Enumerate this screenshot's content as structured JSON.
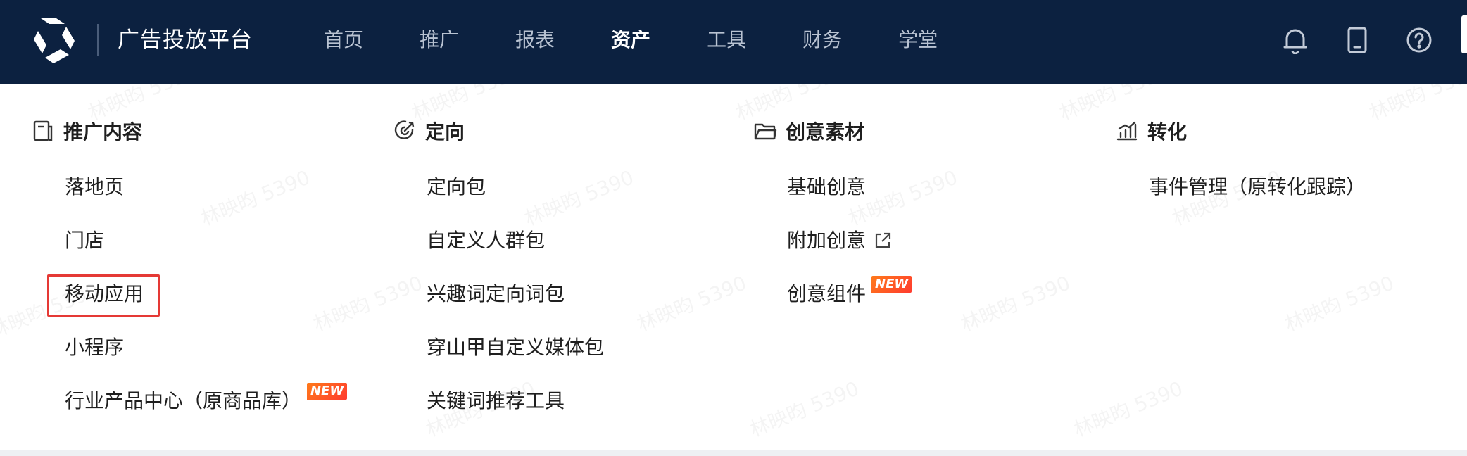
{
  "header": {
    "brand": "广告投放平台",
    "nav": [
      "首页",
      "推广",
      "报表",
      "资产",
      "工具",
      "财务",
      "学堂"
    ],
    "active_index": 3,
    "icons": [
      "bell-icon",
      "tablet-icon",
      "help-icon"
    ]
  },
  "columns": [
    {
      "title": "推广内容",
      "icon": "document-icon",
      "items": [
        "落地页",
        "门店",
        "移动应用",
        "小程序",
        "行业产品中心（原商品库）"
      ]
    },
    {
      "title": "定向",
      "icon": "target-icon",
      "items": [
        "定向包",
        "自定义人群包",
        "兴趣词定向词包",
        "穿山甲自定义媒体包",
        "关键词推荐工具"
      ]
    },
    {
      "title": "创意素材",
      "icon": "folder-icon",
      "items": [
        "基础创意",
        "附加创意",
        "创意组件"
      ]
    },
    {
      "title": "转化",
      "icon": "bar-chart-icon",
      "items": [
        "事件管理（原转化跟踪）"
      ]
    }
  ],
  "badge_text": "NEW",
  "watermark_text": "林映昀 5390",
  "colors": {
    "topbar": "#0c2140",
    "highlight": "#e53935",
    "badge": "#ff5a1f"
  }
}
